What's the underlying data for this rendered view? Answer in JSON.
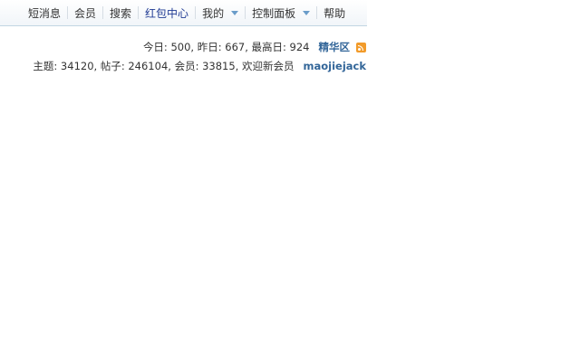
{
  "nav": {
    "items": [
      {
        "label": "短消息",
        "dropdown": false,
        "highlight": false
      },
      {
        "label": "会员",
        "dropdown": false,
        "highlight": false
      },
      {
        "label": "搜索",
        "dropdown": false,
        "highlight": false
      },
      {
        "label": "红包中心",
        "dropdown": false,
        "highlight": true
      },
      {
        "label": "我的",
        "dropdown": true,
        "highlight": false
      },
      {
        "label": "控制面板",
        "dropdown": true,
        "highlight": false
      },
      {
        "label": "帮助",
        "dropdown": false,
        "highlight": false
      }
    ]
  },
  "stats": {
    "line1": "今日: 500, 昨日: 667, 最高日: 924",
    "digest_link": "精华区",
    "line2": "主题: 34120, 帖子: 246104, 会员: 33815, 欢迎新会员",
    "new_member": "maojiejack"
  },
  "colors": {
    "link": "#336699",
    "highlight": "#1f3a93",
    "rss": "#f29b2a"
  }
}
